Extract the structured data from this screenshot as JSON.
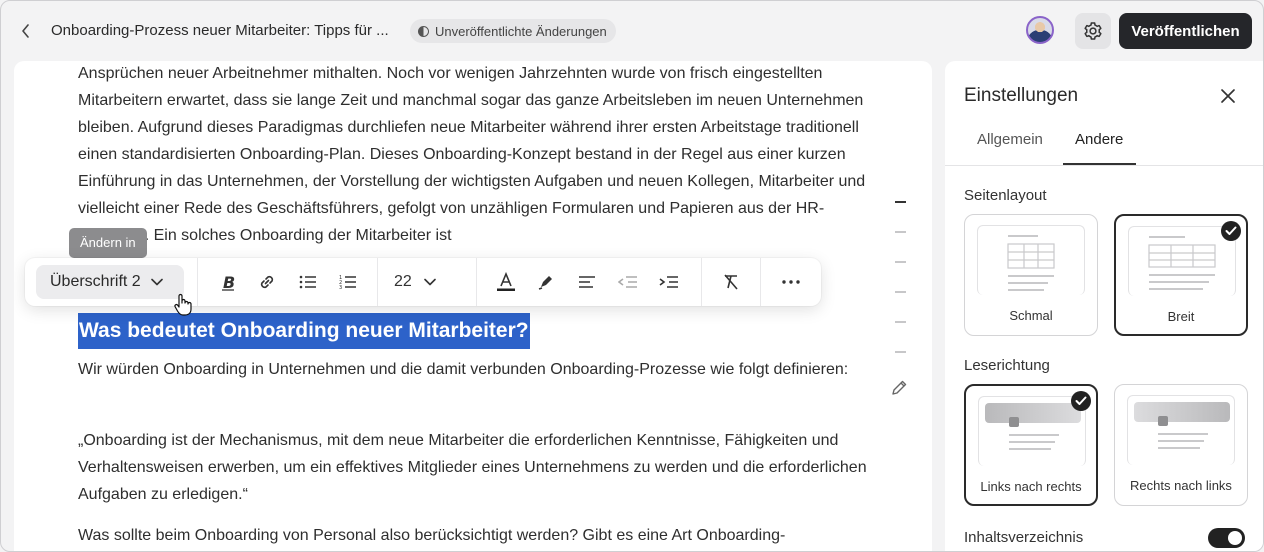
{
  "header": {
    "title": "Onboarding-Prozess neuer Mitarbeiter: Tipps für ...",
    "status": "Unveröffentlichte Änderungen",
    "publish_label": "Veröffentlichen"
  },
  "editor": {
    "paragraph1": "Ansprüchen neuer Arbeitnehmer mithalten. Noch vor wenigen Jahrzehnten wurde von frisch eingestellten Mitarbeitern erwartet, dass sie lange Zeit und manchmal sogar das ganze Arbeitsleben im neuen Unternehmen bleiben. Aufgrund dieses Paradigmas durchliefen neue Mitarbeiter während ihrer ersten Arbeitstage traditionell einen standardisierten Onboarding-Plan. Dieses Onboarding-Konzept bestand in der Regel aus einer kurzen Einführung in das Unternehmen, der Vorstellung der wichtigsten Aufgaben und neuen Kollegen, Mitarbeiter und vielleicht einer Rede des Geschäftsführers, gefolgt von unzähligen Formularen und Papieren aus der HR-Abteilung. Ein solches Onboarding der Mitarbeiter ist",
    "heading": "Was bedeutet Onboarding neuer Mitarbeiter?",
    "paragraph2": "Wir würden Onboarding in Unternehmen und die damit verbunden Onboarding-Prozesse wie folgt definieren:",
    "paragraph3": "„Onboarding ist der Mechanismus, mit dem neue Mitarbeiter die erforderlichen Kenntnisse, Fähigkeiten und Verhaltensweisen erwerben, um ein effektives Mitglieder eines Unternehmens zu werden und die erforderlichen Aufgaben zu erledigen.“",
    "paragraph4": "Was sollte beim Onboarding von Personal also berücksichtigt werden? Gibt es eine Art Onboarding-"
  },
  "toolbar": {
    "tooltip": "Ändern in",
    "block_style": "Überschrift 2",
    "font_size": "22"
  },
  "panel": {
    "title": "Einstellungen",
    "tabs": [
      {
        "label": "Allgemein",
        "active": false
      },
      {
        "label": "Andere",
        "active": true
      }
    ],
    "layout_label": "Seitenlayout",
    "layout_options": [
      {
        "label": "Schmal",
        "selected": false
      },
      {
        "label": "Breit",
        "selected": true
      }
    ],
    "direction_label": "Leserichtung",
    "direction_options": [
      {
        "label": "Links nach rechts",
        "selected": true
      },
      {
        "label": "Rechts nach links",
        "selected": false
      }
    ],
    "toc_label": "Inhaltsverzeichnis",
    "toc_enabled": true
  },
  "colors": {
    "accent_dark": "#25262a",
    "selection": "#2d62c9"
  }
}
